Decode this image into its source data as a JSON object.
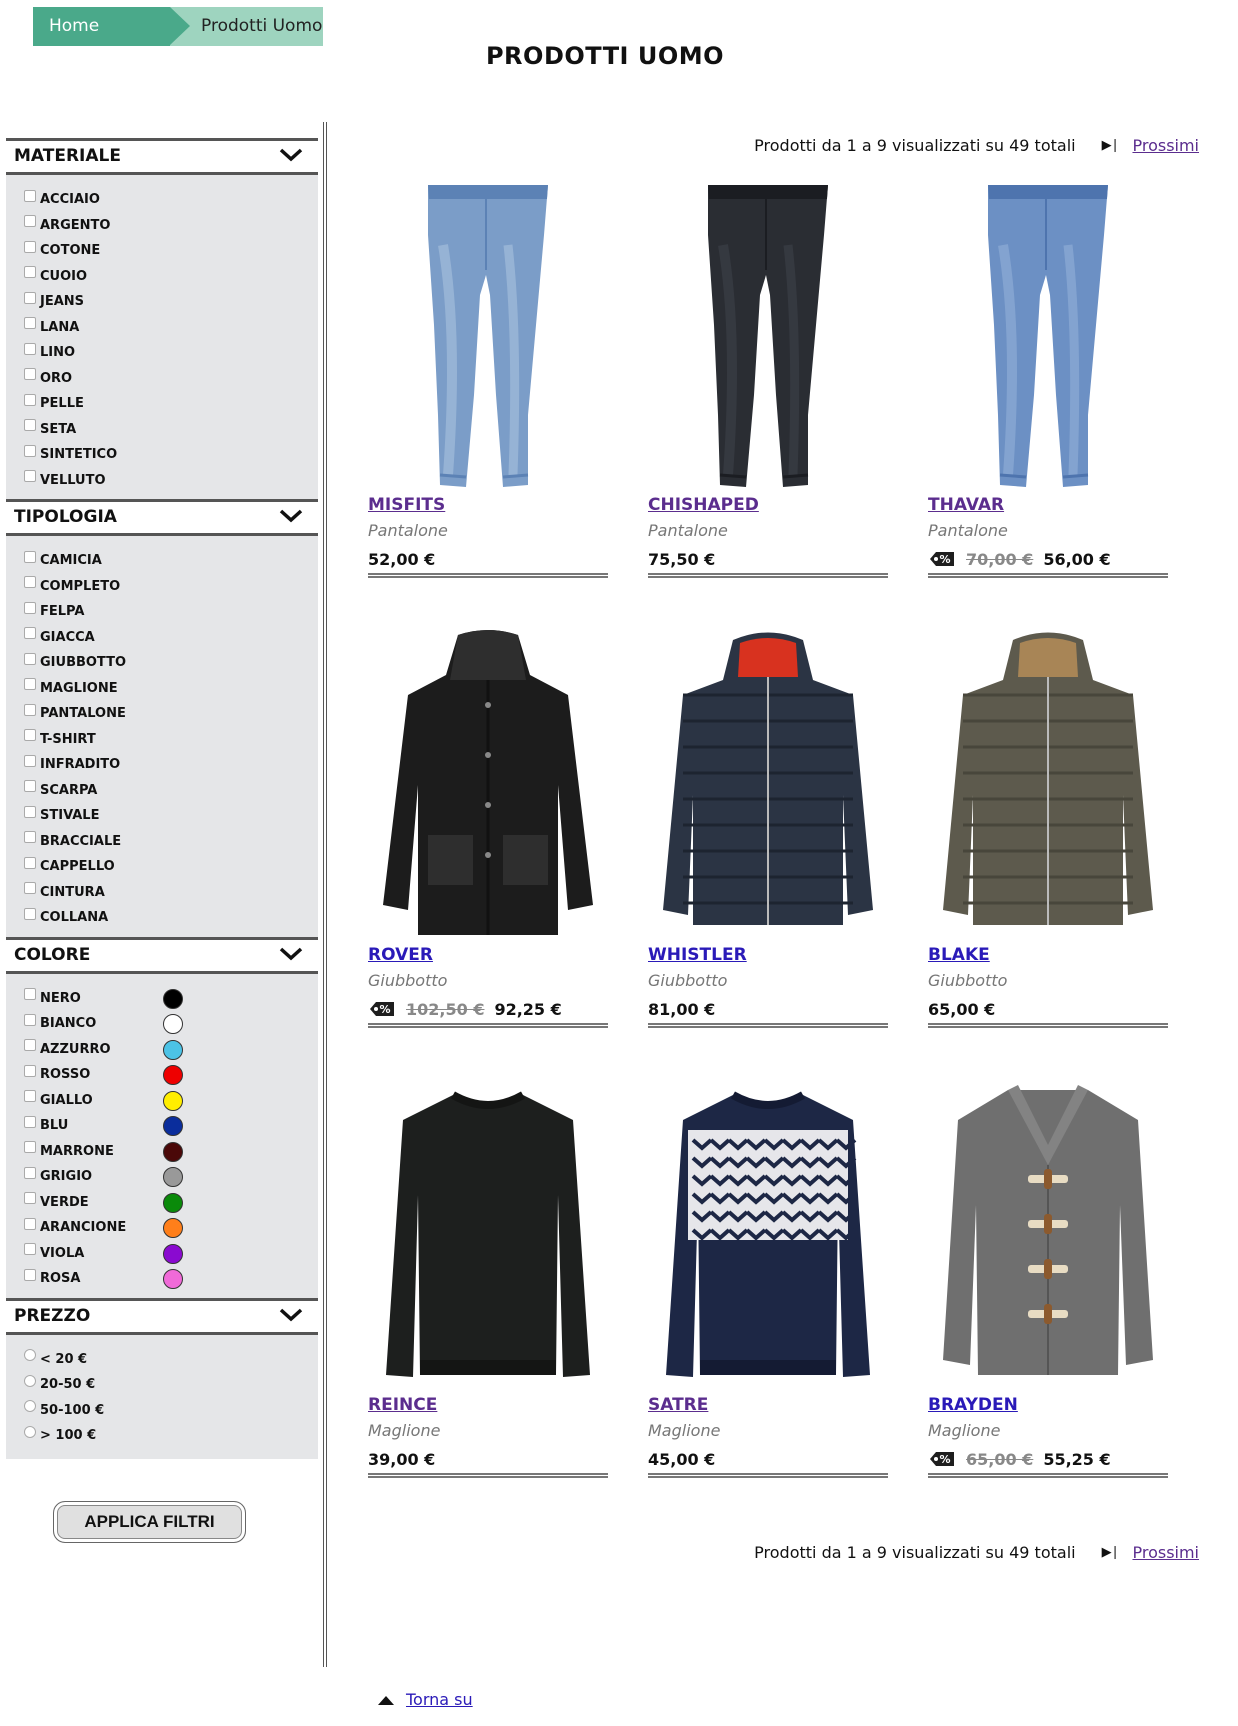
{
  "breadcrumb": {
    "home": "Home",
    "current": "Prodotti Uomo"
  },
  "page_title": "PRODOTTI UOMO",
  "filters": {
    "materiale": {
      "title": "MATERIALE",
      "items": [
        "ACCIAIO",
        "ARGENTO",
        "COTONE",
        "CUOIO",
        "JEANS",
        "LANA",
        "LINO",
        "ORO",
        "PELLE",
        "SETA",
        "SINTETICO",
        "VELLUTO"
      ]
    },
    "tipologia": {
      "title": "TIPOLOGIA",
      "items": [
        "CAMICIA",
        "COMPLETO",
        "FELPA",
        "GIACCA",
        "GIUBBOTTO",
        "MAGLIONE",
        "PANTALONE",
        "T-SHIRT",
        "INFRADITO",
        "SCARPA",
        "STIVALE",
        "BRACCIALE",
        "CAPPELLO",
        "CINTURA",
        "COLLANA"
      ]
    },
    "colore": {
      "title": "COLORE",
      "items": [
        {
          "label": "NERO",
          "color": "#000000"
        },
        {
          "label": "BIANCO",
          "color": "#ffffff"
        },
        {
          "label": "AZZURRO",
          "color": "#4cc3e6"
        },
        {
          "label": "ROSSO",
          "color": "#ee0000"
        },
        {
          "label": "GIALLO",
          "color": "#ffee00"
        },
        {
          "label": "BLU",
          "color": "#0a2d9c"
        },
        {
          "label": "MARRONE",
          "color": "#4a0808"
        },
        {
          "label": "GRIGIO",
          "color": "#999999"
        },
        {
          "label": "VERDE",
          "color": "#0a8a0a"
        },
        {
          "label": "ARANCIONE",
          "color": "#ff7f1a"
        },
        {
          "label": "VIOLA",
          "color": "#8a0ad0"
        },
        {
          "label": "ROSA",
          "color": "#f06ad8"
        }
      ]
    },
    "prezzo": {
      "title": "PREZZO",
      "items": [
        "< 20 €",
        "20-50 €",
        "50-100 €",
        "> 100 €"
      ]
    }
  },
  "apply_button": "APPLICA FILTRI",
  "pager": {
    "count": "Prodotti da 1 a 9 visualizzati su 49 totali",
    "next": "Prossimi"
  },
  "products": [
    {
      "name": "MISFITS",
      "type": "Pantalone",
      "old_price": "",
      "price": "52,00 €",
      "image": "jeans-light"
    },
    {
      "name": "CHISHAPED",
      "type": "Pantalone",
      "old_price": "",
      "price": "75,50 €",
      "image": "jeans-dark"
    },
    {
      "name": "THAVAR",
      "type": "Pantalone",
      "old_price": "70,00 €",
      "price": "56,00 €",
      "image": "jeans-mid"
    },
    {
      "name": "ROVER",
      "type": "Giubbotto",
      "old_price": "102,50 €",
      "price": "92,25 €",
      "image": "parka-black"
    },
    {
      "name": "WHISTLER",
      "type": "Giubbotto",
      "old_price": "",
      "price": "81,00 €",
      "image": "puffer-navy"
    },
    {
      "name": "BLAKE",
      "type": "Giubbotto",
      "old_price": "",
      "price": "65,00 €",
      "image": "puffer-olive"
    },
    {
      "name": "REINCE",
      "type": "Maglione",
      "old_price": "",
      "price": "39,00 €",
      "image": "sweater-black"
    },
    {
      "name": "SATRE",
      "type": "Maglione",
      "old_price": "",
      "price": "45,00 €",
      "image": "sweater-nordic"
    },
    {
      "name": "BRAYDEN",
      "type": "Maglione",
      "old_price": "65,00 €",
      "price": "55,25 €",
      "image": "cardigan-grey"
    }
  ],
  "back_to_top": "Torna su"
}
